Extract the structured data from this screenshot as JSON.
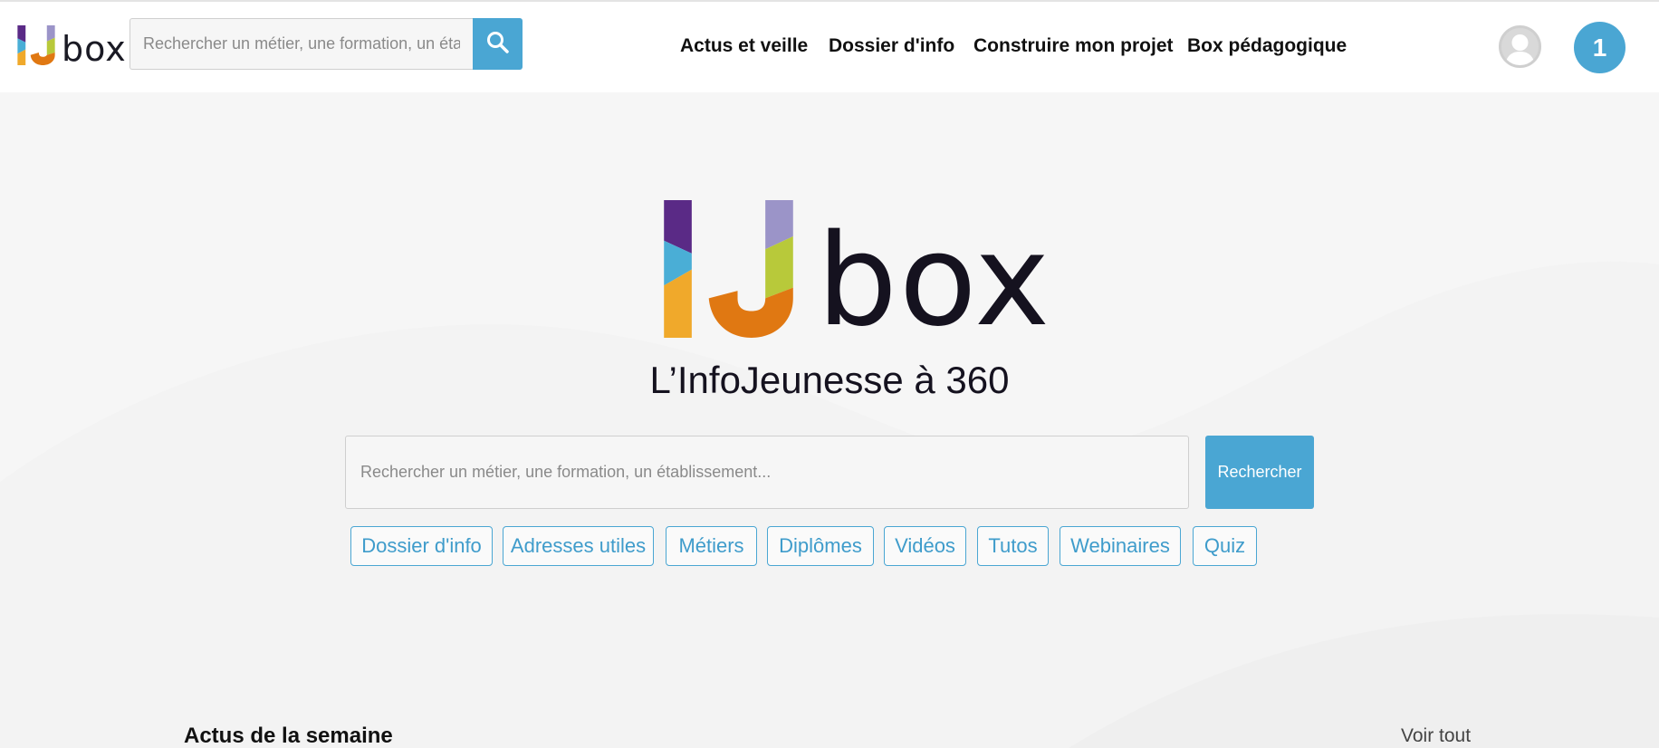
{
  "header": {
    "logo_text": "box",
    "search": {
      "placeholder": "Rechercher un métier, une formation, un établissement..."
    },
    "nav": [
      "Actus et veille",
      "Dossier d'info",
      "Construire mon projet",
      "Box pédagogique"
    ],
    "notifications_count": "1"
  },
  "hero": {
    "logo_text": "box",
    "tagline": "L’InfoJeunesse à 360",
    "search": {
      "placeholder": "Rechercher un métier, une formation, un établissement...",
      "button": "Rechercher"
    },
    "chips": [
      "Dossier d'info",
      "Adresses utiles",
      "Métiers",
      "Diplômes",
      "Vidéos",
      "Tutos",
      "Webinaires",
      "Quiz"
    ]
  },
  "news": {
    "title": "Actus de la semaine",
    "see_all": "Voir tout"
  },
  "colors": {
    "accent": "#4aa6d3",
    "logo_purple": "#5a2a86",
    "logo_blue": "#4aaed6",
    "logo_yellow": "#f0a92b",
    "logo_orange": "#e07812",
    "logo_lavender": "#9b94c8",
    "logo_green": "#b8c93a"
  }
}
